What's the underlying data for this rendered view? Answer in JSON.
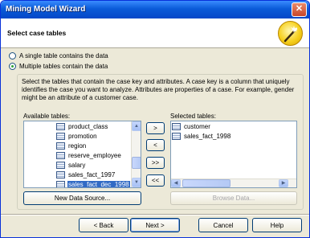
{
  "window": {
    "title": "Mining Model Wizard",
    "close_glyph": "✕"
  },
  "header": {
    "title": "Select case tables",
    "icon": "magic-wand-icon"
  },
  "options": {
    "single_table": "A single table contains the data",
    "multiple_tables": "Multiple tables contain the data",
    "selected": "multiple_tables"
  },
  "description": "Select the tables that contain the case key and attributes. A case key is a column that uniquely identifies the case you want to analyze. Attributes are properties of a case. For example, gender might be an attribute of a customer case.",
  "available": {
    "label": "Available tables:",
    "items": [
      "product_class",
      "promotion",
      "region",
      "reserve_employee",
      "salary",
      "sales_fact_1997",
      "sales_fact_dec_1998"
    ],
    "selected_item": "sales_fact_dec_1998"
  },
  "selected": {
    "label": "Selected tables:",
    "items": [
      "customer",
      "sales_fact_1998"
    ]
  },
  "move_buttons": {
    "add": ">",
    "remove": "<",
    "add_all": ">>",
    "remove_all": "<<"
  },
  "new_data_source_label": "New Data Source...",
  "browse_data_label": "Browse Data...",
  "footer": {
    "back": "< Back",
    "next": "Next >",
    "cancel": "Cancel",
    "help": "Help"
  },
  "colors": {
    "title_bar": "#0a5bd8",
    "selection": "#316ac5",
    "dialog_bg": "#ece9d8"
  }
}
